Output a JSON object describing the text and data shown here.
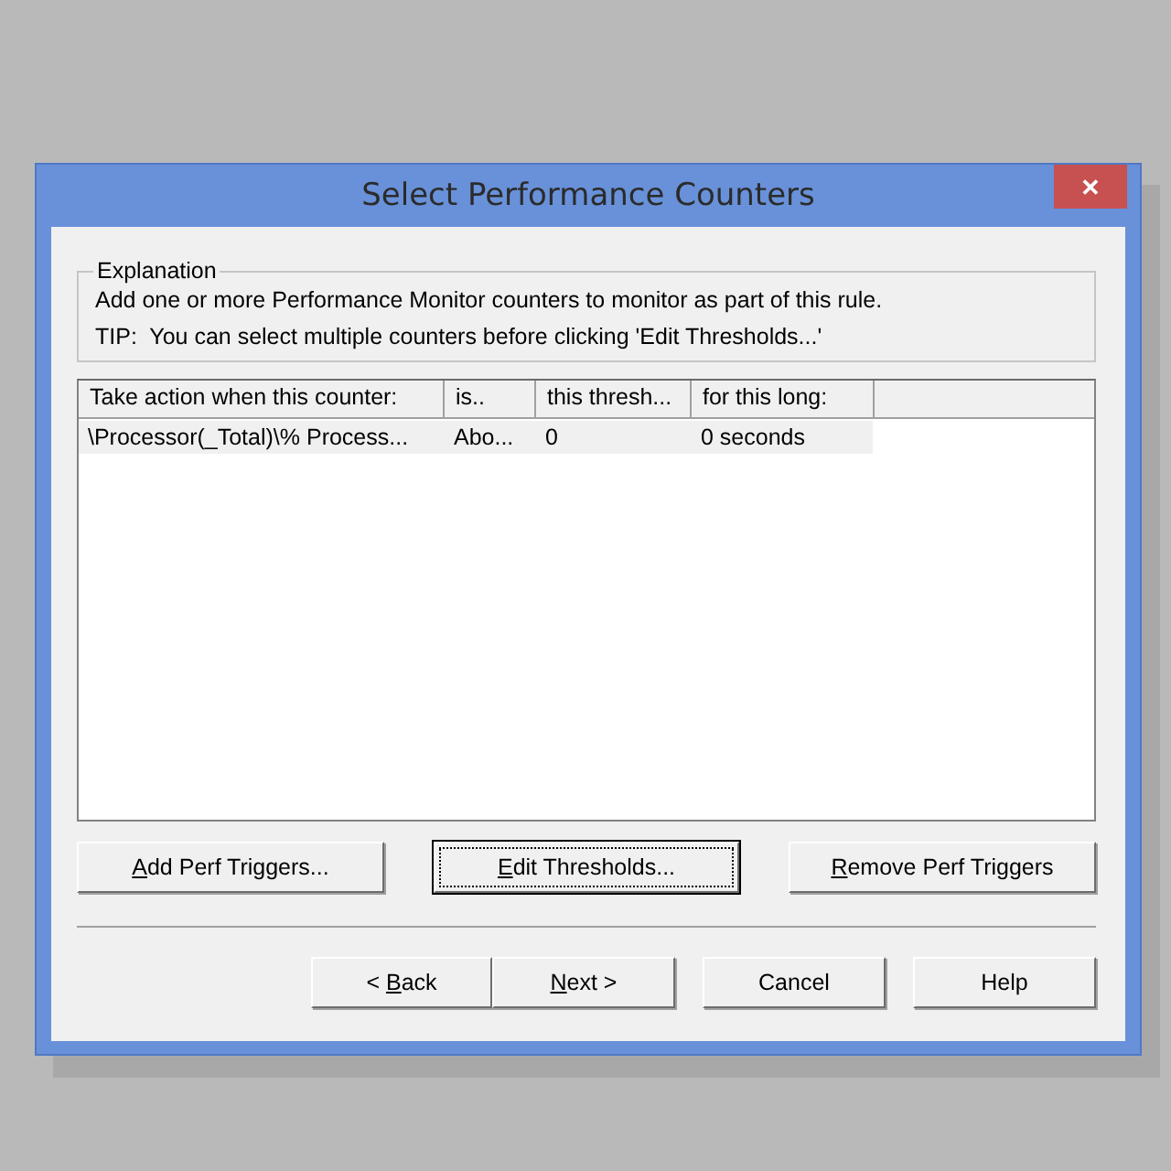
{
  "window": {
    "title": "Select Performance Counters",
    "close": "✕"
  },
  "explanation": {
    "legend": "Explanation",
    "lines": [
      "Add one or more Performance Monitor counters to monitor as part of this rule.",
      "TIP:  You can select multiple counters before clicking 'Edit Thresholds...'"
    ]
  },
  "table": {
    "columns": [
      "Take action when this counter:",
      "is..",
      "this thresh...",
      "for this long:"
    ],
    "rows": [
      {
        "cells": [
          "\\Processor(_Total)\\% Process...",
          "Abo...",
          "0",
          "0 seconds"
        ],
        "selected": true
      }
    ]
  },
  "action_buttons": [
    {
      "key": "A",
      "after": "dd Perf Triggers...",
      "focused": false
    },
    {
      "key": "E",
      "after": "dit Thresholds...",
      "focused": true
    },
    {
      "key": "R",
      "after": "emove Perf Triggers",
      "focused": false
    }
  ],
  "nav_buttons": [
    {
      "before": "< ",
      "key": "B",
      "after": "ack",
      "focused": false
    },
    {
      "key": "N",
      "after": "ext >",
      "focused": false
    },
    {
      "after": "Cancel",
      "focused": false
    },
    {
      "after": "Help",
      "focused": false
    }
  ]
}
